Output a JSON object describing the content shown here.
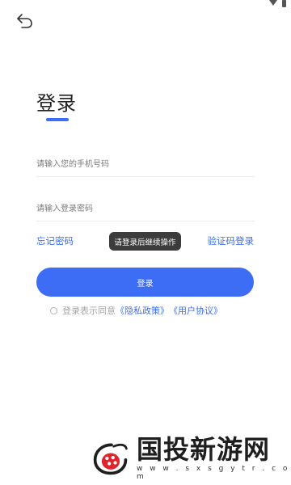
{
  "header": {
    "back_icon": "back-arrow-icon"
  },
  "login": {
    "title": "登录",
    "phone_placeholder": "请输入您的手机号码",
    "password_placeholder": "请输入登录密码",
    "forgot_password": "忘记密码",
    "sms_login": "验证码登录",
    "toast": "请登录后继续操作",
    "submit_label": "登录",
    "agreement_prefix": "登录表示同意",
    "privacy_policy": "《隐私政策》",
    "user_agreement": "《用户协议》"
  },
  "watermark": {
    "name": "国投新游网",
    "url": "w w w . s x s g y t r . c o m"
  },
  "colors": {
    "accent": "#3d6cf5",
    "toast_bg": "#3c3c3c"
  }
}
